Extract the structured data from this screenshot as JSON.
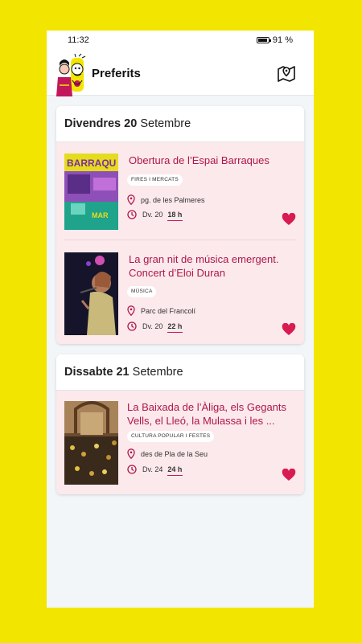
{
  "status": {
    "time": "11:32",
    "battery": "91 %",
    "battery_level": 0.91
  },
  "app": {
    "title": "Preferits"
  },
  "icons": {
    "logo": "giants-mascot-logo",
    "map": "map-pin-icon",
    "location": "location-pin-icon",
    "clock": "clock-icon",
    "favorite": "heart-icon"
  },
  "colors": {
    "background": "#F2E600",
    "accent": "#C2185B",
    "event_bg": "#FBE9EC",
    "title": "#B0164A"
  },
  "days": [
    {
      "weekday": "Divendres",
      "day": "20",
      "month": "Setembre",
      "events": [
        {
          "title": "Obertura de l’Espai Barraques",
          "category": "FIRES I MERCATS",
          "location": "pg. de les Palmeres",
          "date": "Dv. 20",
          "hour": "18 h",
          "favorite": true
        },
        {
          "title": "La gran nit de música emergent. Concert d’Eloi Duran",
          "category": "MÚSICA",
          "location": "Parc del Francolí",
          "date": "Dv. 20",
          "hour": "22 h",
          "favorite": true
        }
      ]
    },
    {
      "weekday": "Dissabte",
      "day": "21",
      "month": "Setembre",
      "events": [
        {
          "title": "La Baixada de l’Àliga, els Gegants Vells, el Lleó, la Mulassa i les ...",
          "category": "CULTURA POPULAR I FESTES",
          "location": "des de Pla de la Seu",
          "date": "Dv. 24",
          "hour": "24 h",
          "favorite": true
        }
      ]
    }
  ]
}
